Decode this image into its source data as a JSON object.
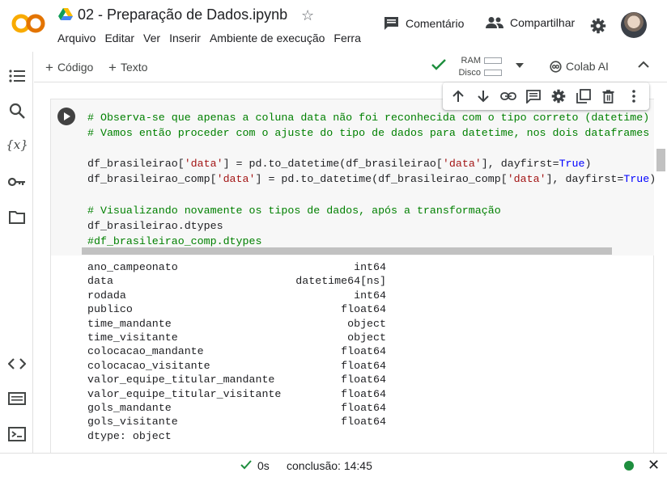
{
  "app": {
    "logo_text": "CO",
    "title": "02 - Preparação de Dados.ipynb",
    "menu": [
      "Arquivo",
      "Editar",
      "Ver",
      "Inserir",
      "Ambiente de execução",
      "Ferra"
    ],
    "comment_label": "Comentário",
    "share_label": "Compartilhar"
  },
  "toolbar": {
    "add_code": "Código",
    "add_text": "Texto",
    "ram_label": "RAM",
    "disk_label": "Disco",
    "colab_ai": "Colab AI"
  },
  "cell": {
    "code": {
      "line1": "# Observa-se que apenas a coluna data não foi reconhecida com o tipo correto (datetime)",
      "line2": "# Vamos então proceder com o ajuste do tipo de dados para datetime, nos dois dataframes",
      "line4_a": "df_brasileirao[",
      "line4_s": "'data'",
      "line4_b": "] = pd.to_datetime(df_brasileirao[",
      "line4_s2": "'data'",
      "line4_c": "], dayfirst=",
      "line4_kw": "True",
      "line4_d": ")",
      "line5_a": "df_brasileirao_comp[",
      "line5_s": "'data'",
      "line5_b": "] = pd.to_datetime(df_brasileirao_comp[",
      "line5_s2": "'data'",
      "line5_c": "], dayfirst=",
      "line5_kw": "True",
      "line5_d": ")",
      "line7": "# Visualizando novamente os tipos de dados, após a transformação",
      "line8": "df_brasileirao.dtypes",
      "line9": "#df_brasileirao_comp.dtypes"
    },
    "output": {
      "rows": [
        {
          "col": "ano_campeonato",
          "type": "int64"
        },
        {
          "col": "data",
          "type": "datetime64[ns]"
        },
        {
          "col": "rodada",
          "type": "int64"
        },
        {
          "col": "publico",
          "type": "float64"
        },
        {
          "col": "time_mandante",
          "type": "object"
        },
        {
          "col": "time_visitante",
          "type": "object"
        },
        {
          "col": "colocacao_mandante",
          "type": "float64"
        },
        {
          "col": "colocacao_visitante",
          "type": "float64"
        },
        {
          "col": "valor_equipe_titular_mandante",
          "type": "float64"
        },
        {
          "col": "valor_equipe_titular_visitante",
          "type": "float64"
        },
        {
          "col": "gols_mandante",
          "type": "float64"
        },
        {
          "col": "gols_visitante",
          "type": "float64"
        }
      ],
      "footer": "dtype: object"
    }
  },
  "status": {
    "duration": "0s",
    "completion": "conclusão: 14:45"
  },
  "colors": {
    "accent_orange": "#f9ab00",
    "ok_green": "#1e8e3e"
  }
}
